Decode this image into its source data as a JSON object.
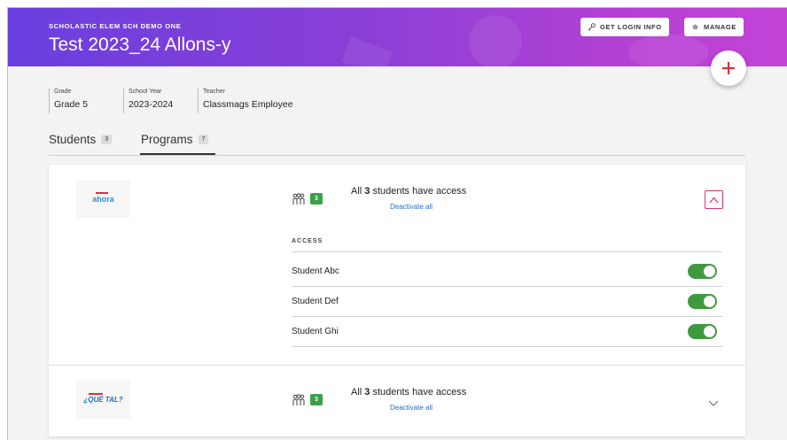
{
  "header": {
    "org_name": "SCHOLASTIC ELEM SCH DEMO ONE",
    "class_title": "Test 2023_24 Allons-y",
    "get_login_label": "GET LOGIN INFO",
    "manage_label": "MANAGE"
  },
  "class_info": {
    "grade_label": "Grade",
    "grade_value": "Grade 5",
    "year_label": "School Year",
    "year_value": "2023-2024",
    "teacher_label": "Teacher",
    "teacher_value": "Classmags Employee"
  },
  "tabs": [
    {
      "label": "Students",
      "count": "3",
      "active": false
    },
    {
      "label": "Programs",
      "count": "7",
      "active": true
    }
  ],
  "programs": [
    {
      "logo_text": "ahora",
      "student_count": "3",
      "access_prefix": "All ",
      "access_count": "3",
      "access_suffix": " students have access",
      "deactivate_label": "Deactivate all",
      "expanded": true,
      "access_header": "ACCESS",
      "students": [
        {
          "name": "Student Abc",
          "enabled": true
        },
        {
          "name": "Student Def",
          "enabled": true
        },
        {
          "name": "Student Ghi",
          "enabled": true
        }
      ]
    },
    {
      "logo_text": "¿QUÉ TAL?",
      "student_count": "3",
      "access_prefix": "All ",
      "access_count": "3",
      "access_suffix": " students have access",
      "deactivate_label": "Deactivate all",
      "expanded": false
    }
  ],
  "colors": {
    "header_gradient_start": "#6a3fe0",
    "header_gradient_end": "#c244d6",
    "toggle_on": "#3f9a3f",
    "badge_green": "#3aa14a",
    "link_blue": "#1f6fd0",
    "fab_plus_red": "#d9333b"
  },
  "icons": {
    "login": "key-icon",
    "manage": "gear-icon",
    "add": "plus-icon",
    "students": "people-icon",
    "collapse": "chevron-up-icon",
    "expand": "chevron-down-icon"
  }
}
